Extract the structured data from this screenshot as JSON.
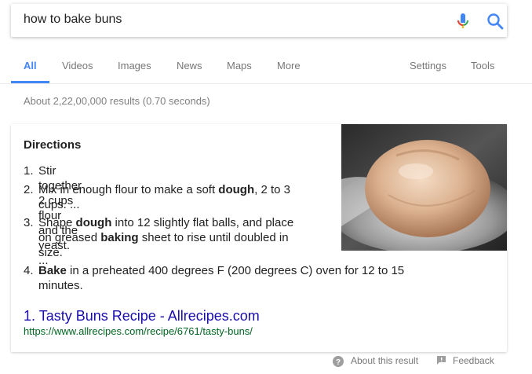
{
  "search": {
    "query": "how to bake buns"
  },
  "tabs": {
    "all": "All",
    "videos": "Videos",
    "images": "Images",
    "news": "News",
    "maps": "Maps",
    "more": "More",
    "settings": "Settings",
    "tools": "Tools"
  },
  "stats": "About 2,22,00,000 results (0.70 seconds)",
  "featured": {
    "title": "Directions",
    "steps": [
      {
        "num": "1.",
        "line1": "Stir together 2 cups flour and the yeast. ..."
      },
      {
        "num": "2.",
        "line1a": "Mix in enough flour to make a soft ",
        "line1b": "dough",
        "line1c": ", 2 to 3",
        "line2": "cups. ..."
      },
      {
        "num": "3.",
        "line1a": "Shape ",
        "line1b": "dough",
        "line1c": " into 12 slightly flat balls, and place",
        "line2a": "on greased ",
        "line2b": "baking",
        "line2c": " sheet to rise until doubled in",
        "line3": "size."
      },
      {
        "num": "4.",
        "line1a": "Bake",
        "line1b": " in a preheated 400 degrees F (200 degrees C) oven for 12 to 15",
        "line2": "minutes."
      }
    ],
    "link_text": "1. Tasty Buns Recipe - Allrecipes.com",
    "link_url": "https://www.allrecipes.com/recipe/6761/tasty-buns/"
  },
  "footer": {
    "about": "About this result",
    "feedback": "Feedback"
  },
  "colors": {
    "link": "#1a0dab",
    "url": "#006621",
    "accent": "#4285f4"
  }
}
